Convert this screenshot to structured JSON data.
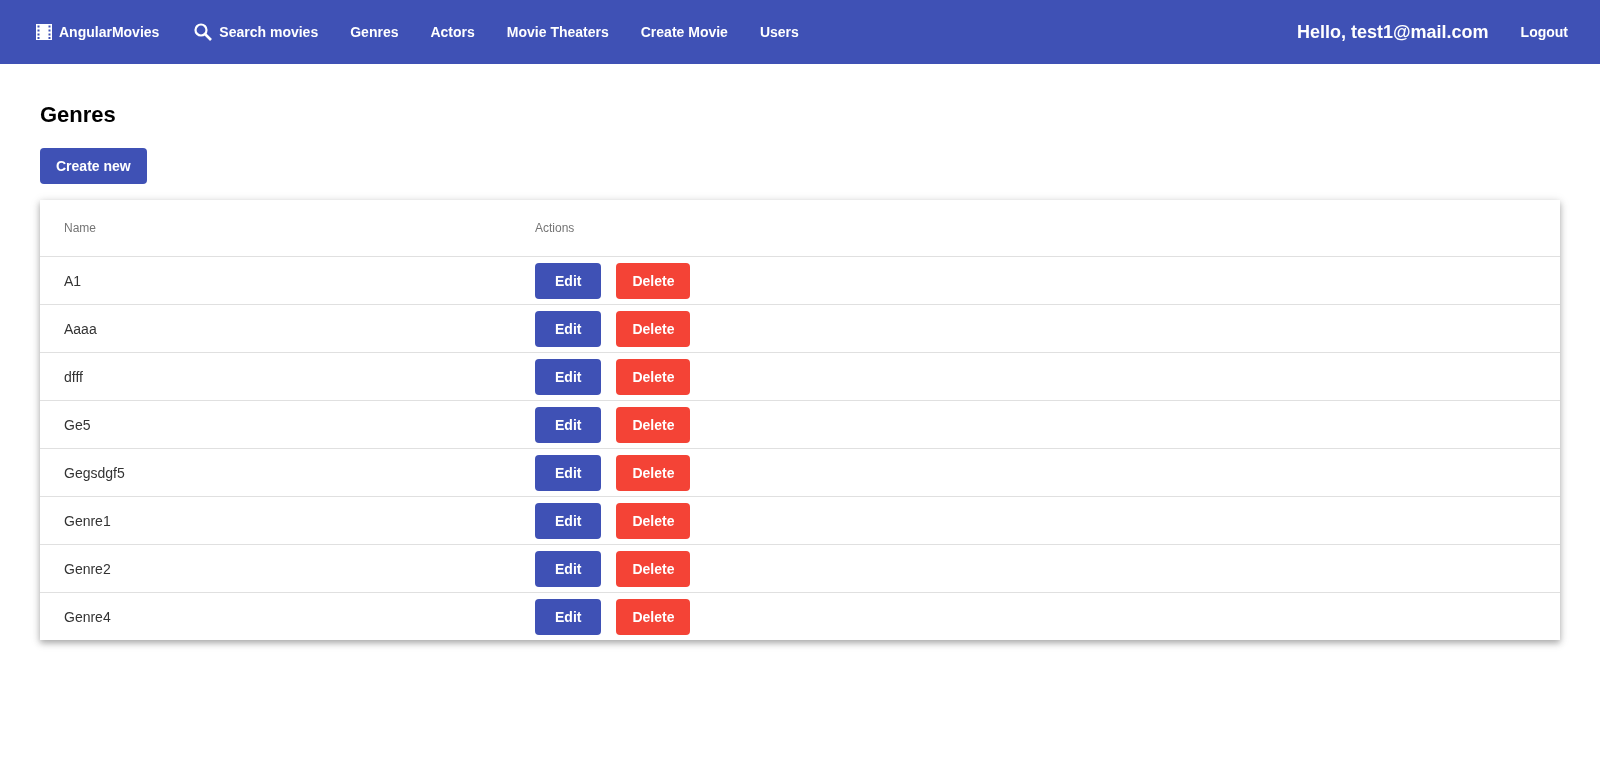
{
  "toolbar": {
    "brand": "AngularMovies",
    "links": [
      "Search movies",
      "Genres",
      "Actors",
      "Movie Theaters",
      "Create Movie",
      "Users"
    ],
    "greeting": "Hello, test1@mail.com",
    "logout": "Logout"
  },
  "page": {
    "title": "Genres",
    "create_button": "Create new"
  },
  "table": {
    "columns": [
      "Name",
      "Actions"
    ],
    "rows": [
      {
        "name": "A1",
        "edit": "Edit",
        "delete": "Delete"
      },
      {
        "name": "Aaaa",
        "edit": "Edit",
        "delete": "Delete"
      },
      {
        "name": "dfff",
        "edit": "Edit",
        "delete": "Delete"
      },
      {
        "name": "Ge5",
        "edit": "Edit",
        "delete": "Delete"
      },
      {
        "name": "Gegsdgf5",
        "edit": "Edit",
        "delete": "Delete"
      },
      {
        "name": "Genre1",
        "edit": "Edit",
        "delete": "Delete"
      },
      {
        "name": "Genre2",
        "edit": "Edit",
        "delete": "Delete"
      },
      {
        "name": "Genre4",
        "edit": "Edit",
        "delete": "Delete"
      }
    ]
  }
}
